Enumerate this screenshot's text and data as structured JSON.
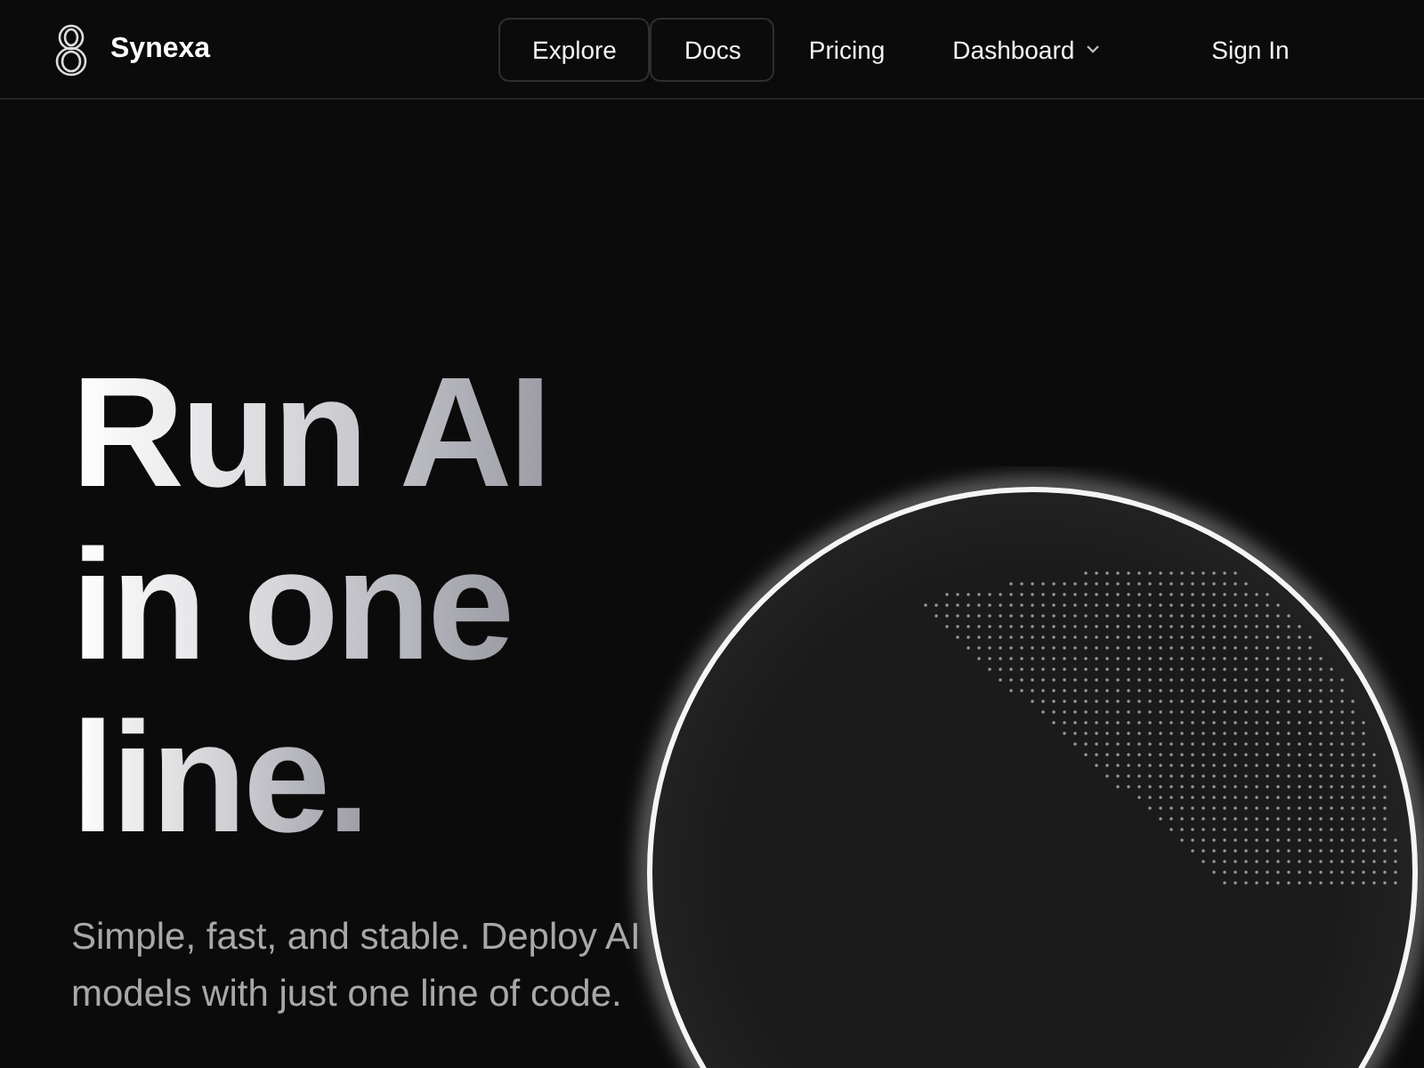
{
  "brand": {
    "name": "Synexa"
  },
  "nav": [
    {
      "label": "Explore",
      "outlined": true,
      "dropdown": false
    },
    {
      "label": "Docs",
      "outlined": true,
      "dropdown": false
    },
    {
      "label": "Pricing",
      "outlined": false,
      "dropdown": false
    },
    {
      "label": "Dashboard",
      "outlined": false,
      "dropdown": true
    }
  ],
  "sign_in": "Sign In",
  "hero": {
    "headline": [
      "Run AI",
      "in one",
      "line."
    ],
    "subtitle": "Simple, fast, and stable. Deploy AI models with just one line of code."
  }
}
